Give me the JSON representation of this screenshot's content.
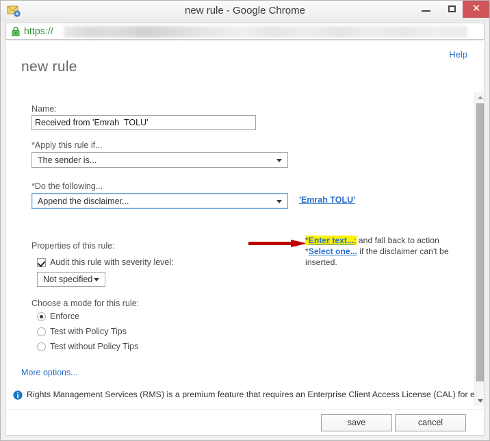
{
  "window": {
    "title": "new rule - Google Chrome",
    "app_icon": "envelope-gear-icon",
    "minimize_label": "–",
    "maximize_label": "□",
    "close_label": "✕",
    "close_color": "#cf5459"
  },
  "urlbar": {
    "lock_icon": "lock-icon",
    "scheme": "https://",
    "redacted": true
  },
  "page": {
    "help_label": "Help",
    "title": "new rule",
    "name_label": "Name:",
    "name_value": "Received from 'Emrah  TOLU'",
    "apply_label": "*Apply this rule if...",
    "apply_value": "The sender is...",
    "sender_link": "'Emrah TOLU'",
    "do_label": "*Do the following...",
    "do_value": "Append the disclaimer...",
    "action_part1": "*",
    "action_link1": "Enter text...",
    "action_part2": "; and fall back to action ",
    "action_part3": "*",
    "action_link2": "Select one...",
    "action_part4": " if the disclaimer can't be inserted.",
    "highlight_color": "#fff200",
    "annotation_arrow_color": "#c00000",
    "properties_label": "Properties of this rule:",
    "audit_checkbox_label": "Audit this rule with severity level:",
    "audit_checked": true,
    "severity_value": "Not specified",
    "mode_label": "Choose a mode for this rule:",
    "modes": [
      {
        "label": "Enforce",
        "selected": true
      },
      {
        "label": "Test with Policy Tips",
        "selected": false
      },
      {
        "label": "Test without Policy Tips",
        "selected": false
      }
    ],
    "more_options_label": "More options...",
    "rms_icon": "info-icon",
    "rms_notice": "Rights Management Services (RMS) is a premium feature that requires an Enterprise Client Access License (CAL) for each",
    "link_color": "#2a6fc9"
  },
  "scrollbar": {
    "up_arrow": "scroll-up-arrow",
    "down_arrow": "scroll-down-arrow",
    "thumb": "scroll-thumb"
  },
  "footer": {
    "save_label": "save",
    "cancel_label": "cancel"
  }
}
